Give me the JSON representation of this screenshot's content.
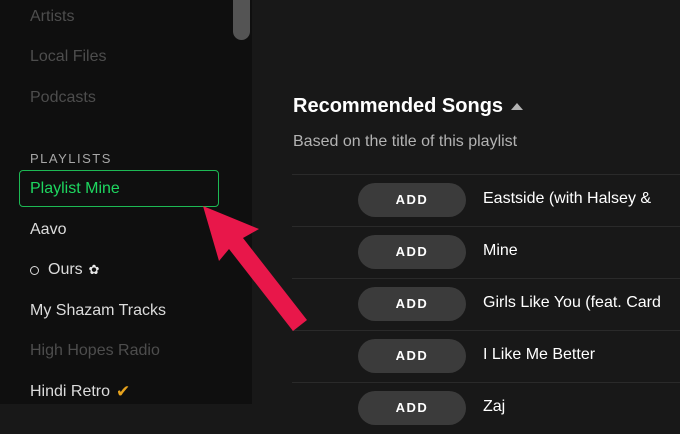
{
  "sidebar": {
    "nav_items": [
      "Artists",
      "Local Files",
      "Podcasts"
    ],
    "section_label": "PLAYLISTS",
    "playlists": [
      {
        "label": "Playlist Mine",
        "selected": true
      },
      {
        "label": "Aavo"
      },
      {
        "label": "Ours",
        "prefix_icon": "circle-icon",
        "suffix_icon": "flower-icon"
      },
      {
        "label": "My Shazam Tracks"
      },
      {
        "label": "High Hopes Radio",
        "dimmed": true
      },
      {
        "label": "Hindi Retro",
        "suffix_icon": "check-icon"
      }
    ]
  },
  "main": {
    "title": "Recommended Songs",
    "subtitle": "Based on the title of this playlist",
    "add_label": "ADD",
    "songs": [
      "Eastside (with Halsey & ",
      "Mine",
      "Girls Like You (feat. Card",
      "I Like Me Better",
      "Zaj"
    ]
  },
  "colors": {
    "accent": "#1db954",
    "arrow": "#e8174a",
    "background": "#181818",
    "sidebar": "#0f0f0f"
  }
}
